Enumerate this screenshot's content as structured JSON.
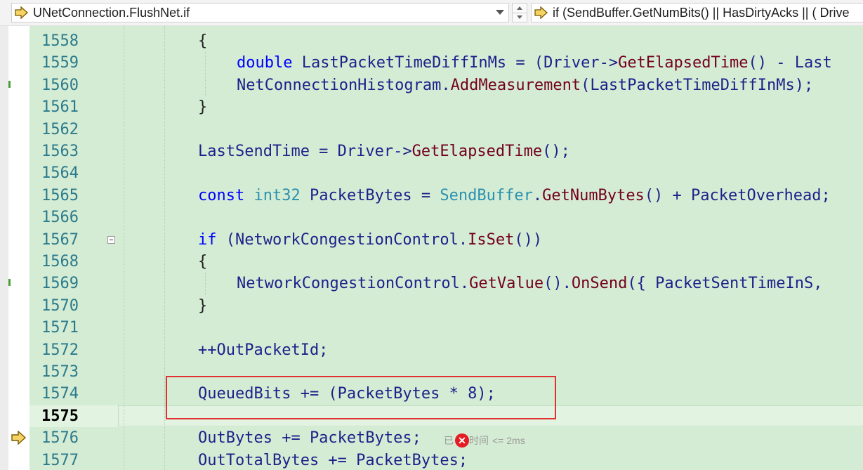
{
  "navigation": {
    "scope_label": "UNetConnection.FlushNet.if",
    "member_label": "if (SendBuffer.GetNumBits() || HasDirtyAcks || ( Drive"
  },
  "editor": {
    "current_line": "1575",
    "lines": [
      {
        "num": "1558",
        "tokens": [
          {
            "t": "{",
            "c": "p"
          }
        ]
      },
      {
        "num": "1559",
        "tokens": [
          {
            "t": "double",
            "c": "k"
          },
          {
            "t": " LastPacketTimeDiffInMs = (Driver->",
            "c": ""
          },
          {
            "t": "GetElapsedTime",
            "c": "f"
          },
          {
            "t": "() - Last",
            "c": ""
          }
        ]
      },
      {
        "num": "1560",
        "tokens": [
          {
            "t": "NetConnectionHistogram.",
            "c": ""
          },
          {
            "t": "AddMeasurement",
            "c": "f"
          },
          {
            "t": "(LastPacketTimeDiffInMs);",
            "c": ""
          }
        ]
      },
      {
        "num": "1561",
        "tokens": [
          {
            "t": "}",
            "c": "p"
          }
        ]
      },
      {
        "num": "1562",
        "tokens": []
      },
      {
        "num": "1563",
        "tokens": [
          {
            "t": "LastSendTime = Driver->",
            "c": ""
          },
          {
            "t": "GetElapsedTime",
            "c": "f"
          },
          {
            "t": "();",
            "c": ""
          }
        ]
      },
      {
        "num": "1564",
        "tokens": []
      },
      {
        "num": "1565",
        "tokens": [
          {
            "t": "const",
            "c": "k"
          },
          {
            "t": " ",
            "c": ""
          },
          {
            "t": "int32",
            "c": "t"
          },
          {
            "t": " PacketBytes = ",
            "c": ""
          },
          {
            "t": "SendBuffer",
            "c": "t"
          },
          {
            "t": ".",
            "c": ""
          },
          {
            "t": "GetNumBytes",
            "c": "f"
          },
          {
            "t": "() + PacketOverhead;",
            "c": ""
          }
        ]
      },
      {
        "num": "1566",
        "tokens": []
      },
      {
        "num": "1567",
        "tokens": [
          {
            "t": "if",
            "c": "k"
          },
          {
            "t": " (NetworkCongestionControl.",
            "c": ""
          },
          {
            "t": "IsSet",
            "c": "f"
          },
          {
            "t": "())",
            "c": ""
          }
        ]
      },
      {
        "num": "1568",
        "tokens": [
          {
            "t": "{",
            "c": "p"
          }
        ]
      },
      {
        "num": "1569",
        "tokens": [
          {
            "t": "NetworkCongestionControl.",
            "c": ""
          },
          {
            "t": "GetValue",
            "c": "f"
          },
          {
            "t": "().",
            "c": ""
          },
          {
            "t": "OnSend",
            "c": "f"
          },
          {
            "t": "({ PacketSentTimeInS,",
            "c": ""
          }
        ]
      },
      {
        "num": "1570",
        "tokens": [
          {
            "t": "}",
            "c": "p"
          }
        ]
      },
      {
        "num": "1571",
        "tokens": []
      },
      {
        "num": "1572",
        "tokens": [
          {
            "t": "++OutPacketId;",
            "c": ""
          }
        ]
      },
      {
        "num": "1573",
        "tokens": []
      },
      {
        "num": "1574",
        "tokens": [
          {
            "t": "QueuedBits += (PacketBytes * 8);",
            "c": ""
          }
        ]
      },
      {
        "num": "1575",
        "tokens": []
      },
      {
        "num": "1576",
        "tokens": [
          {
            "t": "OutBytes += PacketBytes;",
            "c": ""
          }
        ]
      },
      {
        "num": "1577",
        "tokens": [
          {
            "t": "OutTotalBytes += PacketBytes;",
            "c": ""
          }
        ]
      }
    ],
    "perf_tip": {
      "prefix": "已",
      "suffix": "时间",
      "elapsed": "<= 2ms"
    }
  },
  "icons": {
    "scope": "yellow-right-arrow-icon",
    "member": "yellow-right-arrow-icon",
    "execution_pointer": "yellow-right-arrow-icon",
    "error": "red-x-circle-icon"
  },
  "colors": {
    "editor_background": "#d4ecd4",
    "highlight_box": "#e03030",
    "keyword": "#0000ff",
    "type": "#2b91af",
    "function": "#74001f",
    "identifier": "#1f1f8a"
  }
}
